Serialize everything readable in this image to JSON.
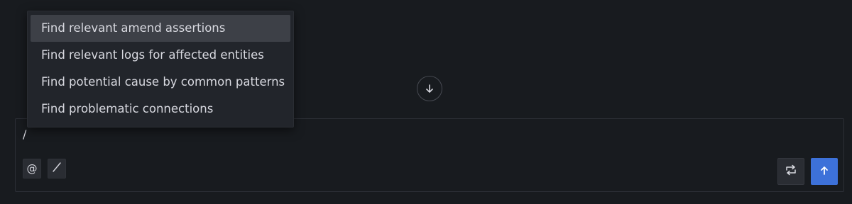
{
  "menu": {
    "items": [
      {
        "label": "Find relevant amend assertions",
        "active": true
      },
      {
        "label": "Find relevant logs for affected entities",
        "active": false
      },
      {
        "label": "Find potential cause by common patterns",
        "active": false
      },
      {
        "label": "Find problematic connections",
        "active": false
      }
    ]
  },
  "composer": {
    "input_value": "/",
    "mention_label": "@",
    "command_icon": "slash-icon",
    "swap_icon": "repeat-icon",
    "send_icon": "arrow-up-icon"
  },
  "scroll_button": {
    "icon": "arrow-down-icon"
  },
  "colors": {
    "background": "#181b1f",
    "menu_bg": "#22252b",
    "menu_active": "#3d4047",
    "accent": "#3d71d9"
  }
}
